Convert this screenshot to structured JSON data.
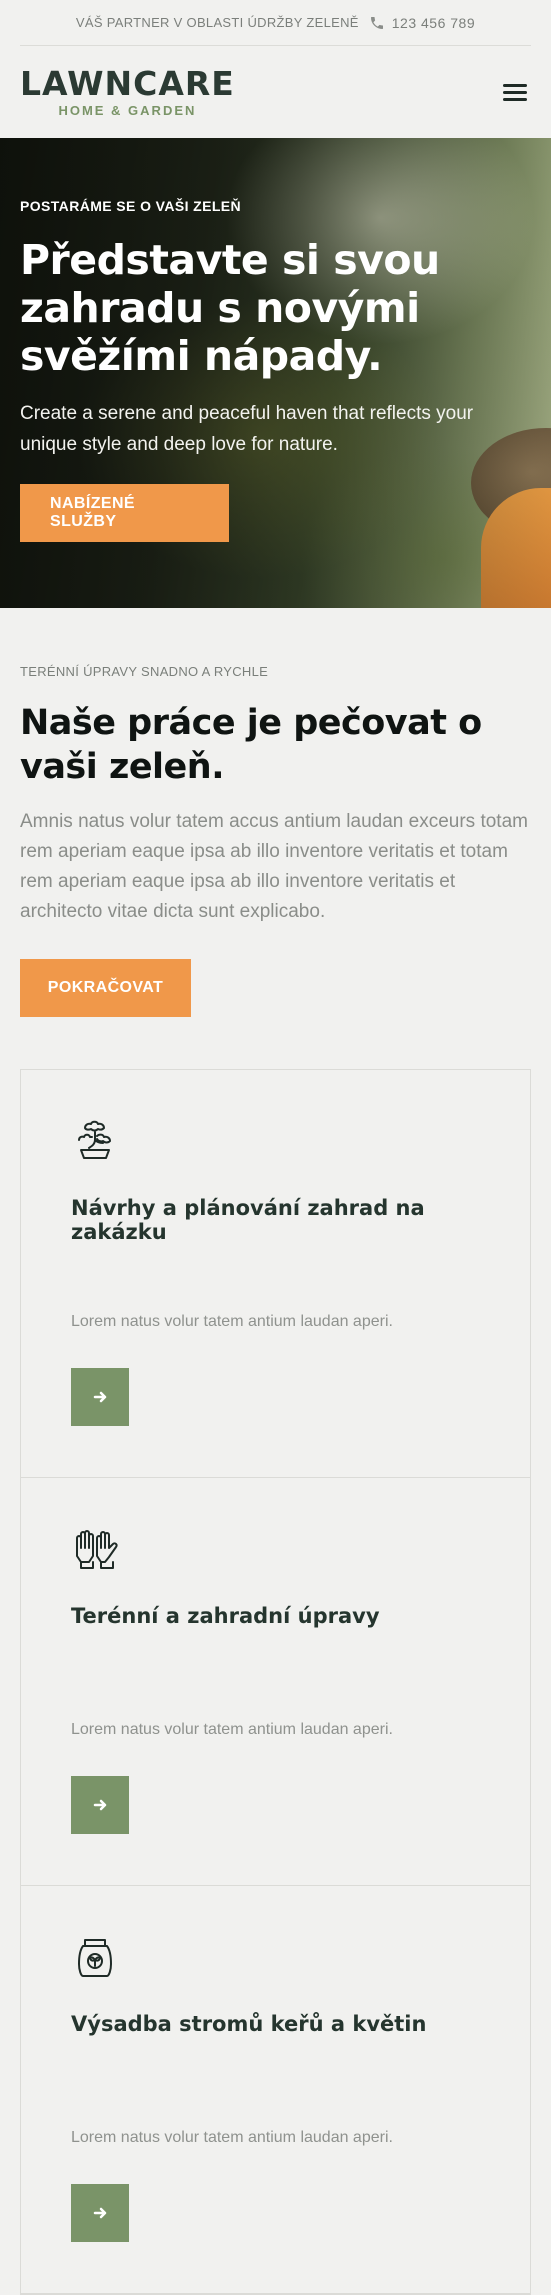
{
  "topbar": {
    "tagline": "VÁŠ PARTNER V OBLASTI ÚDRŽBY ZELENĚ",
    "phone": "123 456 789",
    "phone_icon": "phone-icon"
  },
  "header": {
    "logo_main": "LAWNCARE",
    "logo_sub": "HOME & GARDEN",
    "menu_icon": "hamburger-menu-icon"
  },
  "hero": {
    "eyebrow": "POSTARÁME SE O VAŠI ZELEŇ",
    "title": "Představte si svou zahradu s novými svěžími nápady.",
    "text": "Create a serene and peaceful haven that reflects your unique style and deep love for nature.",
    "button": "NABÍZENÉ SLUŽBY"
  },
  "intro": {
    "eyebrow": "TERÉNNÍ ÚPRAVY SNADNO A RYCHLE",
    "title": "Naše práce je pečovat o vaši zeleň.",
    "text": "Amnis natus volur tatem accus antium laudan exceurs totam rem aperiam eaque ipsa ab illo inventore veritatis et totam rem aperiam eaque ipsa ab illo inventore veritatis et architecto vitae dicta sunt explicabo.",
    "button": "POKRAČOVAT"
  },
  "services": [
    {
      "icon": "bonsai-icon",
      "title": "Návrhy a plánování zahrad na zakázku",
      "text": "Lorem natus volur tatem antium laudan aperi."
    },
    {
      "icon": "gardening-gloves-icon",
      "title": "Terénní a zahradní úpravy",
      "text": "Lorem natus volur tatem antium laudan aperi."
    },
    {
      "icon": "seed-bag-icon",
      "title": "Výsadba stromů keřů a květin",
      "text": "Lorem natus volur tatem antium laudan aperi."
    }
  ],
  "colors": {
    "accent": "#f0984a",
    "green": "#7a9468",
    "background": "#f1f1ef"
  }
}
